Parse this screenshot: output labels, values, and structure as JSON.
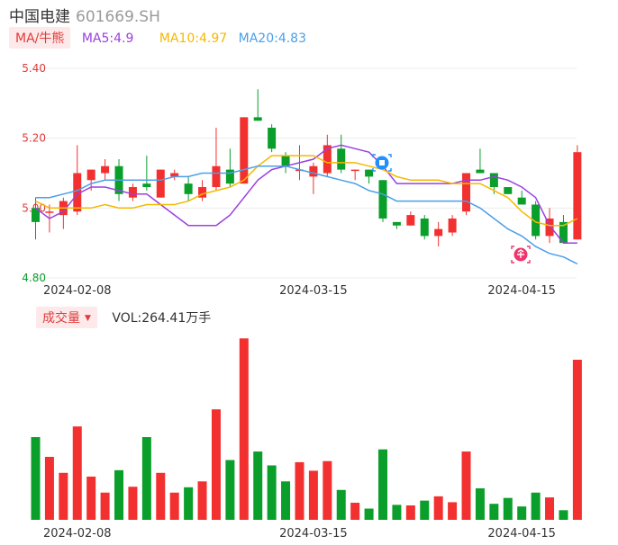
{
  "header": {
    "name": "中国电建",
    "code": "601669.SH"
  },
  "ma_legend": {
    "main": "MA/牛熊",
    "items": [
      {
        "label": "MA5:4.9",
        "color": "#9c3fe0"
      },
      {
        "label": "MA10:4.97",
        "color": "#f5b800"
      },
      {
        "label": "MA20:4.83",
        "color": "#4a9fe8"
      }
    ]
  },
  "volume_legend": {
    "main": "成交量",
    "text": "VOL:264.41万手"
  },
  "colors": {
    "up": "#f23030",
    "down": "#0a9e2a",
    "axis_text": "#e03a3a",
    "grid": "#ececec",
    "date_text": "#333333"
  },
  "icons": [
    "blue-signal-icon",
    "pink-bull-icon"
  ],
  "chart_data": [
    {
      "type": "candlestick",
      "y_ticks": [
        "5.40",
        "5.20",
        "5.00",
        "4.80"
      ],
      "ylim": [
        4.8,
        5.4
      ],
      "x_tick_labels": [
        {
          "index": 3,
          "label": "2024-02-08"
        },
        {
          "index": 20,
          "label": "2024-03-15"
        },
        {
          "index": 35,
          "label": "2024-04-15"
        }
      ],
      "grid": true,
      "candles": [
        [
          5.0,
          4.96,
          5.03,
          4.91
        ],
        [
          4.99,
          4.99,
          5.01,
          4.93
        ],
        [
          4.98,
          5.02,
          5.03,
          4.94
        ],
        [
          4.99,
          5.1,
          5.18,
          4.98
        ],
        [
          5.08,
          5.11,
          5.11,
          5.05
        ],
        [
          5.1,
          5.12,
          5.14,
          5.08
        ],
        [
          5.12,
          5.04,
          5.14,
          5.02
        ],
        [
          5.03,
          5.06,
          5.07,
          5.02
        ],
        [
          5.07,
          5.06,
          5.15,
          5.05
        ],
        [
          5.03,
          5.11,
          5.11,
          5.03
        ],
        [
          5.09,
          5.1,
          5.11,
          5.08
        ],
        [
          5.07,
          5.04,
          5.09,
          5.02
        ],
        [
          5.03,
          5.06,
          5.08,
          5.02
        ],
        [
          5.06,
          5.12,
          5.23,
          5.05
        ],
        [
          5.11,
          5.07,
          5.17,
          5.06
        ],
        [
          5.07,
          5.26,
          5.26,
          5.07
        ],
        [
          5.26,
          5.25,
          5.34,
          5.25
        ],
        [
          5.23,
          5.17,
          5.24,
          5.16
        ],
        [
          5.15,
          5.12,
          5.16,
          5.1
        ],
        [
          5.11,
          5.11,
          5.18,
          5.08
        ],
        [
          5.09,
          5.12,
          5.13,
          5.04
        ],
        [
          5.1,
          5.18,
          5.21,
          5.09
        ],
        [
          5.17,
          5.11,
          5.21,
          5.1
        ],
        [
          5.11,
          5.11,
          5.11,
          5.08
        ],
        [
          5.11,
          5.09,
          5.11,
          5.07
        ],
        [
          5.08,
          4.97,
          5.08,
          4.96
        ],
        [
          4.96,
          4.95,
          4.96,
          4.94
        ],
        [
          4.95,
          4.98,
          4.99,
          4.95
        ],
        [
          4.97,
          4.92,
          4.98,
          4.91
        ],
        [
          4.92,
          4.94,
          4.96,
          4.89
        ],
        [
          4.93,
          4.97,
          4.98,
          4.92
        ],
        [
          4.99,
          5.1,
          5.1,
          4.98
        ],
        [
          5.11,
          5.1,
          5.17,
          5.1
        ],
        [
          5.1,
          5.06,
          5.1,
          5.04
        ],
        [
          5.06,
          5.04,
          5.06,
          5.04
        ],
        [
          5.03,
          5.01,
          5.05,
          5.01
        ],
        [
          5.01,
          4.92,
          5.02,
          4.91
        ],
        [
          4.92,
          4.97,
          5.0,
          4.9
        ],
        [
          4.96,
          4.9,
          4.98,
          4.9
        ],
        [
          4.91,
          5.16,
          5.18,
          4.91
        ]
      ],
      "ma": {
        "MA5": [
          5.0,
          4.97,
          4.99,
          5.04,
          5.06,
          5.06,
          5.05,
          5.04,
          5.04,
          5.01,
          4.98,
          4.95,
          4.95,
          4.95,
          4.98,
          5.03,
          5.08,
          5.11,
          5.12,
          5.13,
          5.14,
          5.17,
          5.18,
          5.17,
          5.16,
          5.12,
          5.07,
          5.07,
          5.07,
          5.07,
          5.07,
          5.08,
          5.08,
          5.09,
          5.08,
          5.06,
          5.03,
          4.95,
          4.9,
          4.9
        ],
        "MA10": [
          5.02,
          5.0,
          5.0,
          5.0,
          5.0,
          5.01,
          5.0,
          5.0,
          5.01,
          5.01,
          5.01,
          5.02,
          5.04,
          5.05,
          5.06,
          5.08,
          5.12,
          5.15,
          5.15,
          5.15,
          5.15,
          5.13,
          5.13,
          5.13,
          5.12,
          5.11,
          5.09,
          5.08,
          5.08,
          5.08,
          5.07,
          5.07,
          5.07,
          5.05,
          5.03,
          4.99,
          4.96,
          4.95,
          4.95,
          4.97
        ],
        "MA20": [
          5.03,
          5.03,
          5.04,
          5.05,
          5.07,
          5.08,
          5.08,
          5.08,
          5.08,
          5.08,
          5.09,
          5.09,
          5.1,
          5.1,
          5.1,
          5.11,
          5.12,
          5.12,
          5.12,
          5.11,
          5.1,
          5.09,
          5.08,
          5.07,
          5.05,
          5.04,
          5.02,
          5.02,
          5.02,
          5.02,
          5.02,
          5.02,
          5.0,
          4.97,
          4.94,
          4.92,
          4.89,
          4.87,
          4.86,
          4.84
        ]
      }
    },
    {
      "type": "bar",
      "series_name": "VOL",
      "unit": "万手",
      "ylim": [
        0,
        300
      ],
      "values": [
        155,
        118,
        88,
        175,
        81,
        51,
        93,
        62,
        155,
        88,
        51,
        61,
        72,
        207,
        112,
        340,
        128,
        102,
        72,
        108,
        92,
        110,
        56,
        32,
        21,
        132,
        28,
        27,
        36,
        44,
        33,
        128,
        59,
        30,
        41,
        25,
        51,
        42,
        18,
        300
      ]
    }
  ]
}
